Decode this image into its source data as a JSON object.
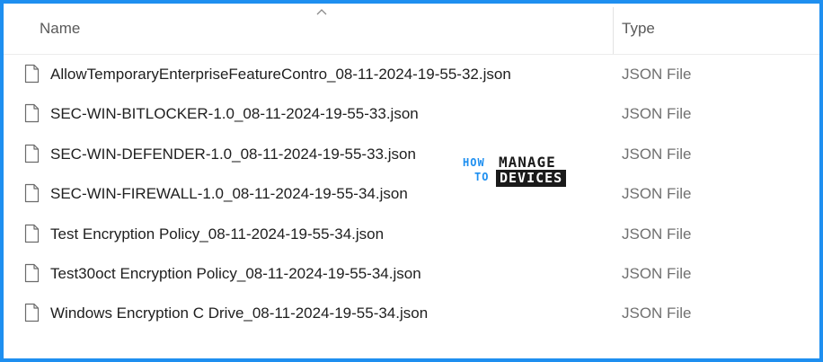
{
  "columns": {
    "name": "Name",
    "type": "Type",
    "sort_icon": "chevron-up-icon"
  },
  "files": [
    {
      "name": "AllowTemporaryEnterpriseFeatureContro_08-11-2024-19-55-32.json",
      "type": "JSON File",
      "icon": "file-icon"
    },
    {
      "name": "SEC-WIN-BITLOCKER-1.0_08-11-2024-19-55-33.json",
      "type": "JSON File",
      "icon": "file-icon"
    },
    {
      "name": "SEC-WIN-DEFENDER-1.0_08-11-2024-19-55-33.json",
      "type": "JSON File",
      "icon": "file-icon"
    },
    {
      "name": "SEC-WIN-FIREWALL-1.0_08-11-2024-19-55-34.json",
      "type": "JSON File",
      "icon": "file-icon"
    },
    {
      "name": "Test Encryption Policy_08-11-2024-19-55-34.json",
      "type": "JSON File",
      "icon": "file-icon"
    },
    {
      "name": "Test30oct Encryption Policy_08-11-2024-19-55-34.json",
      "type": "JSON File",
      "icon": "file-icon"
    },
    {
      "name": "Windows Encryption C Drive_08-11-2024-19-55-34.json",
      "type": "JSON File",
      "icon": "file-icon"
    }
  ],
  "watermark": {
    "how": "HOW",
    "to": "TO",
    "manage": "MANAGE",
    "devices": "DEVICES"
  },
  "colors": {
    "frame_border": "#1e8ff0",
    "watermark_accent": "#1e8ff0",
    "watermark_dark": "#1a1a1a"
  }
}
